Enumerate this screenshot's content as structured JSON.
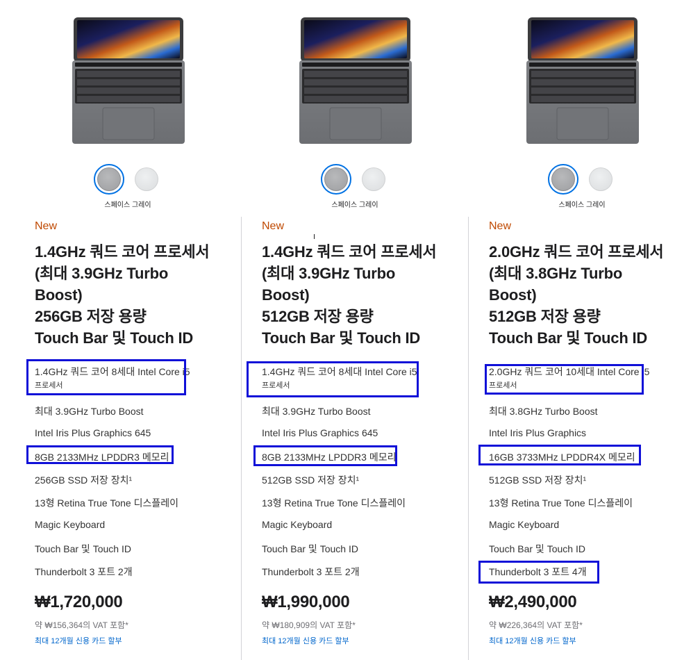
{
  "products": [
    {
      "color_label": "스페이스 그레이",
      "badge": "New",
      "title_lines": [
        "1.4GHz 쿼드 코어 프로세서",
        "(최대 3.9GHz Turbo",
        "Boost)",
        "256GB 저장 용량",
        "Touch Bar 및 Touch ID"
      ],
      "specs": {
        "cpu_line1": "1.4GHz 쿼드 코어 8세대 Intel Core i5",
        "cpu_line2": "프로세서",
        "turbo": "최대 3.9GHz Turbo Boost",
        "graphics": "Intel Iris Plus Graphics 645",
        "memory": "8GB 2133MHz LPDDR3 메모리",
        "storage": "256GB SSD 저장 장치¹",
        "display": "13형 Retina True Tone 디스플레이",
        "keyboard": "Magic Keyboard",
        "touch": "Touch Bar 및 Touch ID",
        "ports": "Thunderbolt 3 포트 2개"
      },
      "price": "₩1,720,000",
      "vat": "약 ₩156,364의 VAT 포함*",
      "installment": "최대 12개월 신용 카드 할부"
    },
    {
      "color_label": "스페이스 그레이",
      "badge": "New",
      "title_lines": [
        "1.4GHz 쿼드 코어 프로세서",
        "(최대 3.9GHz Turbo",
        "Boost)",
        "512GB 저장 용량",
        "Touch Bar 및 Touch ID"
      ],
      "specs": {
        "cpu_line1": "1.4GHz 쿼드 코어 8세대 Intel Core i5",
        "cpu_line2": "프로세서",
        "turbo": "최대 3.9GHz Turbo Boost",
        "graphics": "Intel Iris Plus Graphics 645",
        "memory": "8GB 2133MHz LPDDR3 메모리",
        "storage": "512GB SSD 저장 장치¹",
        "display": "13형 Retina True Tone 디스플레이",
        "keyboard": "Magic Keyboard",
        "touch": "Touch Bar 및 Touch ID",
        "ports": "Thunderbolt 3 포트 2개"
      },
      "price": "₩1,990,000",
      "vat": "약 ₩180,909의 VAT 포함*",
      "installment": "최대 12개월 신용 카드 할부"
    },
    {
      "color_label": "스페이스 그레이",
      "badge": "New",
      "title_lines": [
        "2.0GHz 쿼드 코어 프로세서",
        "(최대 3.8GHz Turbo",
        "Boost)",
        "512GB 저장 용량",
        "Touch Bar 및 Touch ID"
      ],
      "specs": {
        "cpu_line1": "2.0GHz 쿼드 코어 10세대 Intel Core i5",
        "cpu_line2": "프로세서",
        "turbo": "최대 3.8GHz Turbo Boost",
        "graphics": "Intel Iris Plus Graphics",
        "memory": "16GB 3733MHz LPDDR4X 메모리",
        "storage": "512GB SSD 저장 장치¹",
        "display": "13형 Retina True Tone 디스플레이",
        "keyboard": "Magic Keyboard",
        "touch": "Touch Bar 및 Touch ID",
        "ports": "Thunderbolt 3 포트 4개"
      },
      "price": "₩2,490,000",
      "vat": "약 ₩226,364의 VAT 포함*",
      "installment": "최대 12개월 신용 카드 할부"
    }
  ],
  "colors": {
    "badge": "#bf4800",
    "link": "#0066cc",
    "highlight_box": "#1010d8",
    "space_gray": "#a2a3a6",
    "silver": "#e3e4e5"
  },
  "icons": [
    "macbook-pro-space-gray-image",
    "space-gray-swatch",
    "silver-swatch"
  ]
}
